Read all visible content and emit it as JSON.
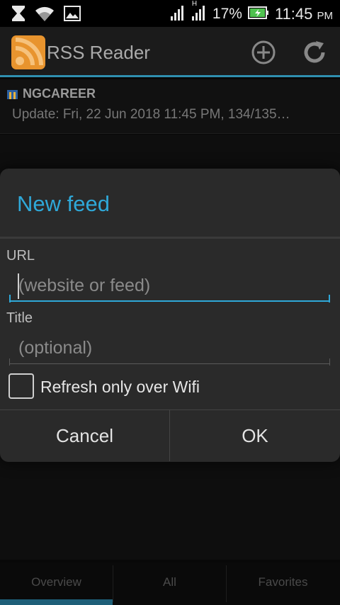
{
  "status_bar": {
    "network_type": "H",
    "battery_percent": "17%",
    "time": "11:45",
    "time_suffix": "PM",
    "icons": [
      "hourglass-icon",
      "wifi-icon",
      "image-icon",
      "signal-icon",
      "signal-icon",
      "battery-charging-icon"
    ]
  },
  "action_bar": {
    "title": "RSS Reader",
    "add_icon": "add-circle-icon",
    "refresh_icon": "refresh-icon"
  },
  "feed_list": {
    "items": [
      {
        "name": "NGCAREER",
        "update": "Update: Fri, 22 Jun 2018 11:45 PM, 134/135…"
      }
    ]
  },
  "dialog": {
    "title": "New feed",
    "url_label": "URL",
    "url_placeholder": "(website or feed)",
    "url_value": "",
    "title_label": "Title",
    "title_placeholder": "(optional)",
    "title_value": "",
    "wifi_checkbox_label": "Refresh only over Wifi",
    "wifi_checked": false,
    "cancel_label": "Cancel",
    "ok_label": "OK"
  },
  "tabs": [
    {
      "label": "Overview",
      "active": true
    },
    {
      "label": "All",
      "active": false
    },
    {
      "label": "Favorites",
      "active": false
    }
  ],
  "colors": {
    "accent": "#2fa8d8",
    "app_icon": "#e8942e",
    "battery": "#4fc24f"
  }
}
